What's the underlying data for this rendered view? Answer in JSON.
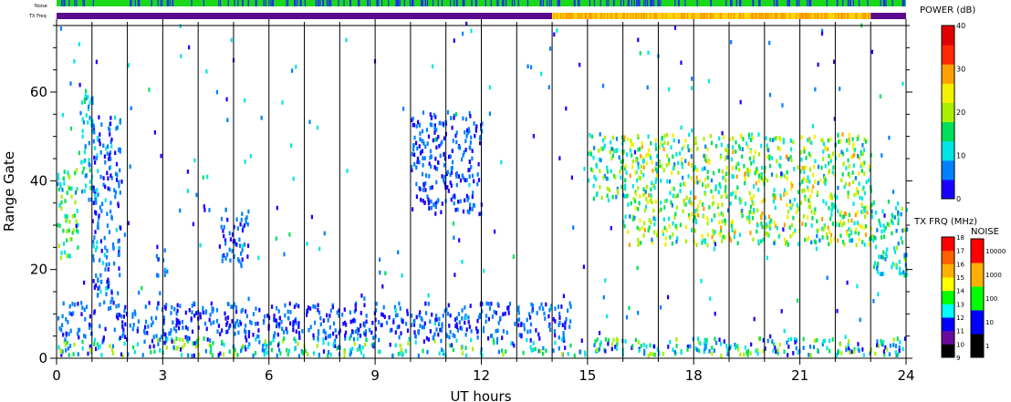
{
  "strip_labels": {
    "noise": "Noise",
    "txfreq": "TX Freq"
  },
  "colors": {
    "noise_strip": "#19d919",
    "noise_strip_alt": "#2424ff",
    "txfreq_low": "#5a0a8c",
    "txfreq_high": "#ffd700",
    "txfreq_high_alt": "#ff9900"
  },
  "chart_data": {
    "type": "heatmap",
    "xlabel": "UT hours",
    "ylabel": "Range Gate",
    "xlim": [
      0,
      24
    ],
    "ylim": [
      0,
      75
    ],
    "x_ticks": [
      "0",
      "3",
      "6",
      "9",
      "12",
      "15",
      "18",
      "21",
      "24"
    ],
    "x_tick_values": [
      0,
      3,
      6,
      9,
      12,
      15,
      18,
      21,
      24
    ],
    "y_ticks": [
      "0",
      "20",
      "40",
      "60"
    ],
    "y_tick_values": [
      0,
      20,
      40,
      60
    ],
    "scan_boundaries_hours": [
      1,
      2,
      3,
      4,
      5,
      6,
      7,
      8,
      9,
      10,
      11,
      12,
      13,
      14,
      15,
      16,
      17,
      18,
      19,
      20,
      21,
      22,
      23
    ],
    "txfreq_switch_hours": [
      14,
      23
    ],
    "regions": [
      {
        "x": [
          0,
          0.6
        ],
        "y": [
          22,
          42
        ],
        "power": [
          8,
          22
        ]
      },
      {
        "x": [
          0.6,
          1.0
        ],
        "y": [
          35,
          60
        ],
        "power": [
          5,
          15
        ]
      },
      {
        "x": [
          1.0,
          1.8
        ],
        "y": [
          12,
          55
        ],
        "power": [
          2,
          10
        ]
      },
      {
        "x": [
          2.8,
          3.1
        ],
        "y": [
          18,
          25
        ],
        "power": [
          2,
          10
        ]
      },
      {
        "x": [
          4.6,
          5.4
        ],
        "y": [
          20,
          33
        ],
        "power": [
          2,
          8
        ]
      },
      {
        "x": [
          10.0,
          12.0
        ],
        "y": [
          32,
          55
        ],
        "power": [
          2,
          8
        ]
      },
      {
        "x": [
          15.0,
          16.0
        ],
        "y": [
          35,
          50
        ],
        "power": [
          8,
          20
        ]
      },
      {
        "x": [
          16.0,
          23.0
        ],
        "y": [
          25,
          50
        ],
        "power": [
          8,
          28
        ]
      },
      {
        "x": [
          23.0,
          24.0
        ],
        "y": [
          18,
          35
        ],
        "power": [
          5,
          20
        ]
      },
      {
        "x": [
          0,
          24
        ],
        "y": [
          0,
          4
        ],
        "power": [
          2,
          22
        ]
      },
      {
        "x": [
          0,
          14.5
        ],
        "y": [
          4,
          12
        ],
        "power": [
          2,
          8
        ]
      }
    ]
  },
  "power_scale": {
    "title": "POWER (dB)",
    "ticks": [
      "0",
      "10",
      "20",
      "30",
      "40"
    ],
    "colors": [
      "#1a00ff",
      "#0080ff",
      "#00e5e5",
      "#00e05a",
      "#a8f000",
      "#f5f000",
      "#ffa000",
      "#ff2800",
      "#e00000"
    ]
  },
  "txfreq_scale": {
    "title": "TX FRQ (MHz)",
    "ticks": [
      "9",
      "10",
      "11",
      "12",
      "13",
      "14",
      "15",
      "16",
      "17",
      "18"
    ],
    "colors": [
      "#000000",
      "#6a0a9a",
      "#0000ff",
      "#00ffff",
      "#00ff00",
      "#ffff00",
      "#ffb000",
      "#ff6000",
      "#ff0000"
    ]
  },
  "noise_scale": {
    "title": "NOISE",
    "ticks": [
      "1",
      "10",
      "100",
      "1000",
      "10000"
    ],
    "colors": [
      "#000000",
      "#0000ff",
      "#00ff00",
      "#ffb000",
      "#ff0000"
    ]
  }
}
